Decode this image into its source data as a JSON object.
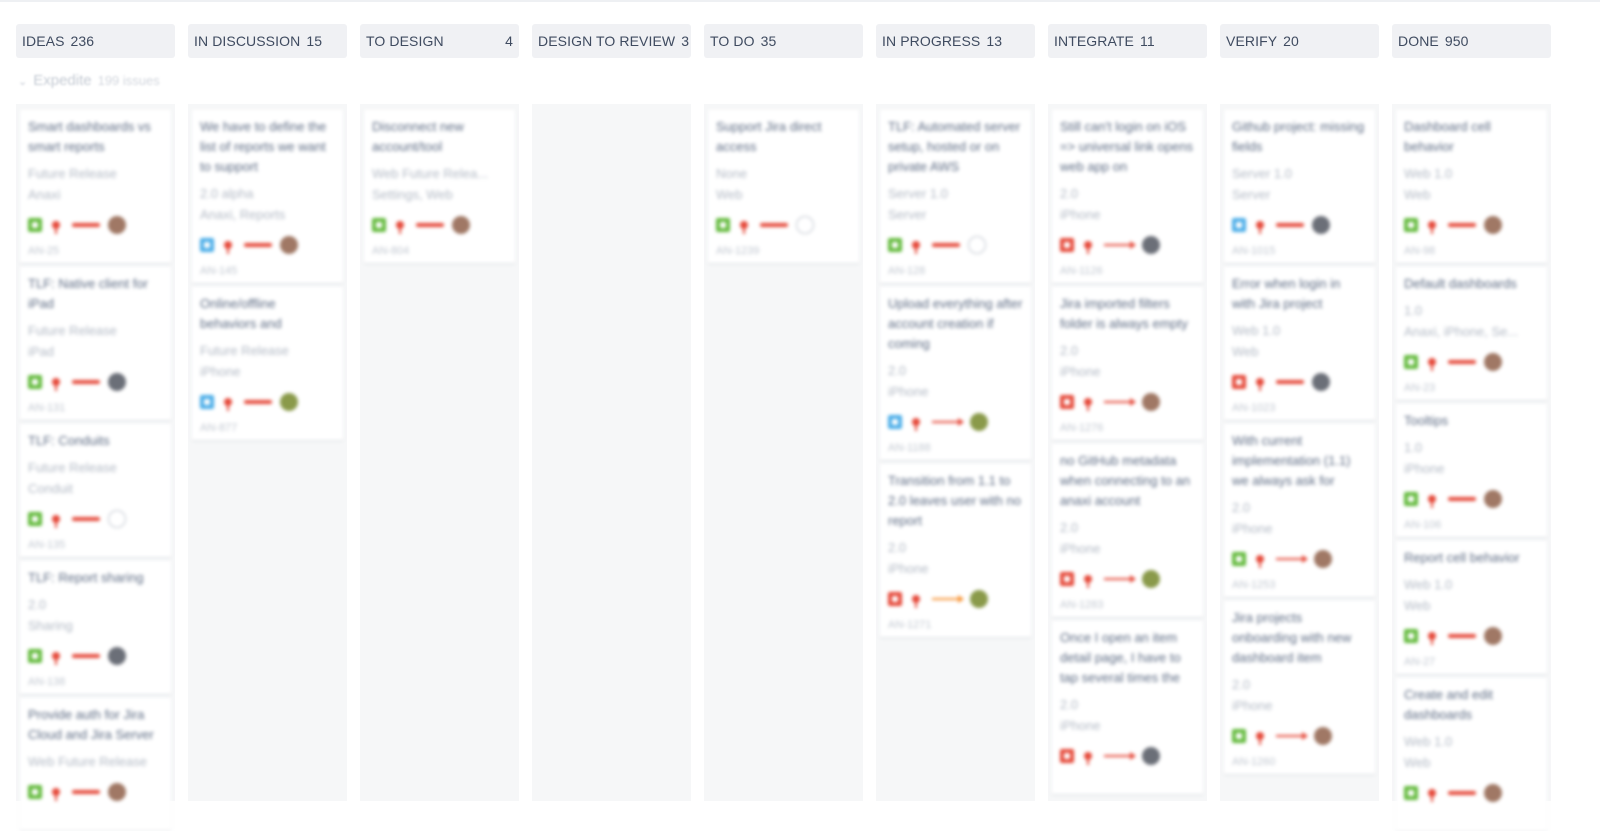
{
  "colors": {
    "story_green": "#63ba3c",
    "task_blue": "#4bade8",
    "bug_red": "#e5493a",
    "priority_red": "#e5493a",
    "priority_orange": "#f79232",
    "avatar_gray": "#6b6f78",
    "avatar_brown": "#a07865",
    "avatar_olive": "#8a9a4a"
  },
  "swimlane": {
    "title": "Expedite",
    "subtitle": "199 issues",
    "chevron": "chevron-down-icon"
  },
  "columns": [
    {
      "name": "IDEAS",
      "count": "236",
      "cards": [
        {
          "summary": "Smart dashboards vs smart reports",
          "version": "Future Release",
          "component": "Anaxi",
          "type": "story",
          "priority_style": "bar",
          "avatar": "avatar_brown",
          "key": "AN-25"
        },
        {
          "summary": "TLF: Native client for iPad",
          "version": "Future Release",
          "component": "iPad",
          "type": "story",
          "priority_style": "bar",
          "avatar": "avatar_gray",
          "key": "AN-131"
        },
        {
          "summary": "TLF: Conduits",
          "version": "Future Release",
          "component": "Conduit",
          "type": "story",
          "priority_style": "bar",
          "avatar": "empty",
          "key": "AN-135"
        },
        {
          "summary": "TLF: Report sharing",
          "version": "2.0",
          "component": "Sharing",
          "type": "story",
          "priority_style": "bar",
          "avatar": "avatar_gray",
          "key": "AN-138"
        },
        {
          "summary": "Provide auth for Jira Cloud and Jira Server",
          "version": "Web Future Release",
          "component": "",
          "type": "story",
          "priority_style": "bar",
          "avatar": "avatar_brown",
          "key": ""
        }
      ]
    },
    {
      "name": "IN DISCUSSION",
      "count": "15",
      "cards": [
        {
          "summary": "We have to define the list of reports we want to support",
          "version": "2.0 alpha",
          "component": "Anaxi, Reports",
          "type": "task",
          "priority_style": "bar",
          "avatar": "avatar_brown",
          "key": "AN-145"
        },
        {
          "summary": "Online/offline behaviors and associated UI",
          "version": "Future Release",
          "component": "iPhone",
          "type": "task",
          "priority_style": "bar",
          "avatar": "avatar_olive",
          "key": "AN-877"
        }
      ]
    },
    {
      "name": "TO DESIGN",
      "count": "4",
      "cards": [
        {
          "summary": "Disconnect new account/tool",
          "version": "Web Future Relea...",
          "component": "Settings, Web",
          "type": "story",
          "priority_style": "bar",
          "avatar": "avatar_brown",
          "key": "AN-804"
        }
      ]
    },
    {
      "name": "DESIGN TO REVIEW",
      "count": "3",
      "cards": []
    },
    {
      "name": "TO DO",
      "count": "35",
      "cards": [
        {
          "summary": "Support Jira direct access",
          "version": "None",
          "component": "Web",
          "type": "story",
          "priority_style": "bar",
          "avatar": "empty",
          "key": "AN-1239"
        }
      ]
    },
    {
      "name": "IN PROGRESS",
      "count": "13",
      "cards": [
        {
          "summary": "TLF: Automated server setup, hosted or on private AWS",
          "version": "Server 1.0",
          "component": "Server",
          "type": "story",
          "priority_style": "bar",
          "avatar": "empty",
          "key": "AN-128"
        },
        {
          "summary": "Upload everything after account creation if coming",
          "version": "2.0",
          "component": "iPhone",
          "type": "task",
          "priority_style": "arrow",
          "avatar": "avatar_olive",
          "key": "AN-1188"
        },
        {
          "summary": "Transition from 1.1 to 2.0 leaves user with no report",
          "version": "2.0",
          "component": "iPhone",
          "type": "bug",
          "priority_style": "arrow_orange",
          "avatar": "avatar_olive",
          "key": "AN-1271"
        }
      ]
    },
    {
      "name": "INTEGRATE",
      "count": "11",
      "cards": [
        {
          "summary": "Still can't login on iOS => universal link opens web app on",
          "version": "2.0",
          "component": "iPhone",
          "type": "bug",
          "priority_style": "arrow",
          "avatar": "avatar_gray",
          "key": "AN-1126"
        },
        {
          "summary": "Jira imported filters folder is always empty",
          "version": "2.0",
          "component": "iPhone",
          "type": "bug",
          "priority_style": "arrow",
          "avatar": "avatar_brown",
          "key": "AN-1276"
        },
        {
          "summary": "no GitHub metadata when connecting to an anaxi account",
          "version": "2.0",
          "component": "iPhone",
          "type": "bug",
          "priority_style": "arrow",
          "avatar": "avatar_olive",
          "key": "AN-1283"
        },
        {
          "summary": "Once I open an item detail page, I have to tap several times the",
          "version": "2.0",
          "component": "iPhone",
          "type": "bug",
          "priority_style": "arrow",
          "avatar": "avatar_gray",
          "key": ""
        }
      ]
    },
    {
      "name": "VERIFY",
      "count": "20",
      "cards": [
        {
          "summary": "Github project: missing fields",
          "version": "Server 1.0",
          "component": "Server",
          "type": "task",
          "priority_style": "bar",
          "avatar": "avatar_gray",
          "key": "AN-1015"
        },
        {
          "summary": "Error when login in with Jira project",
          "version": "Web 1.0",
          "component": "Web",
          "type": "bug",
          "priority_style": "bar",
          "avatar": "avatar_gray",
          "key": "AN-1023"
        },
        {
          "summary": "With current implementation (1.1) we always ask for",
          "version": "2.0",
          "component": "iPhone",
          "type": "story",
          "priority_style": "arrow",
          "avatar": "avatar_brown",
          "key": "AN-1253"
        },
        {
          "summary": "Jira projects onboarding with new dashboard item",
          "version": "2.0",
          "component": "iPhone",
          "type": "story",
          "priority_style": "arrow",
          "avatar": "avatar_brown",
          "key": "AN-1260"
        }
      ]
    },
    {
      "name": "DONE",
      "count": "950",
      "cards": [
        {
          "summary": "Dashboard cell behavior",
          "version": "Web 1.0",
          "component": "Web",
          "type": "story",
          "priority_style": "bar",
          "avatar": "avatar_brown",
          "key": "AN-98"
        },
        {
          "summary": "Default dashboards",
          "version": "1.0",
          "component": "Anaxi, iPhone, Se...",
          "type": "story",
          "priority_style": "bar",
          "avatar": "avatar_brown",
          "key": "AN-23"
        },
        {
          "summary": "Tooltips",
          "version": "1.0",
          "component": "iPhone",
          "type": "story",
          "priority_style": "bar",
          "avatar": "avatar_brown",
          "key": "AN-106"
        },
        {
          "summary": "Report cell behavior",
          "version": "Web 1.0",
          "component": "Web",
          "type": "story",
          "priority_style": "bar",
          "avatar": "avatar_brown",
          "key": "AN-27"
        },
        {
          "summary": "Create and edit dashboards",
          "version": "Web 1.0",
          "component": "Web",
          "type": "story",
          "priority_style": "bar",
          "avatar": "avatar_brown",
          "key": ""
        }
      ]
    }
  ]
}
